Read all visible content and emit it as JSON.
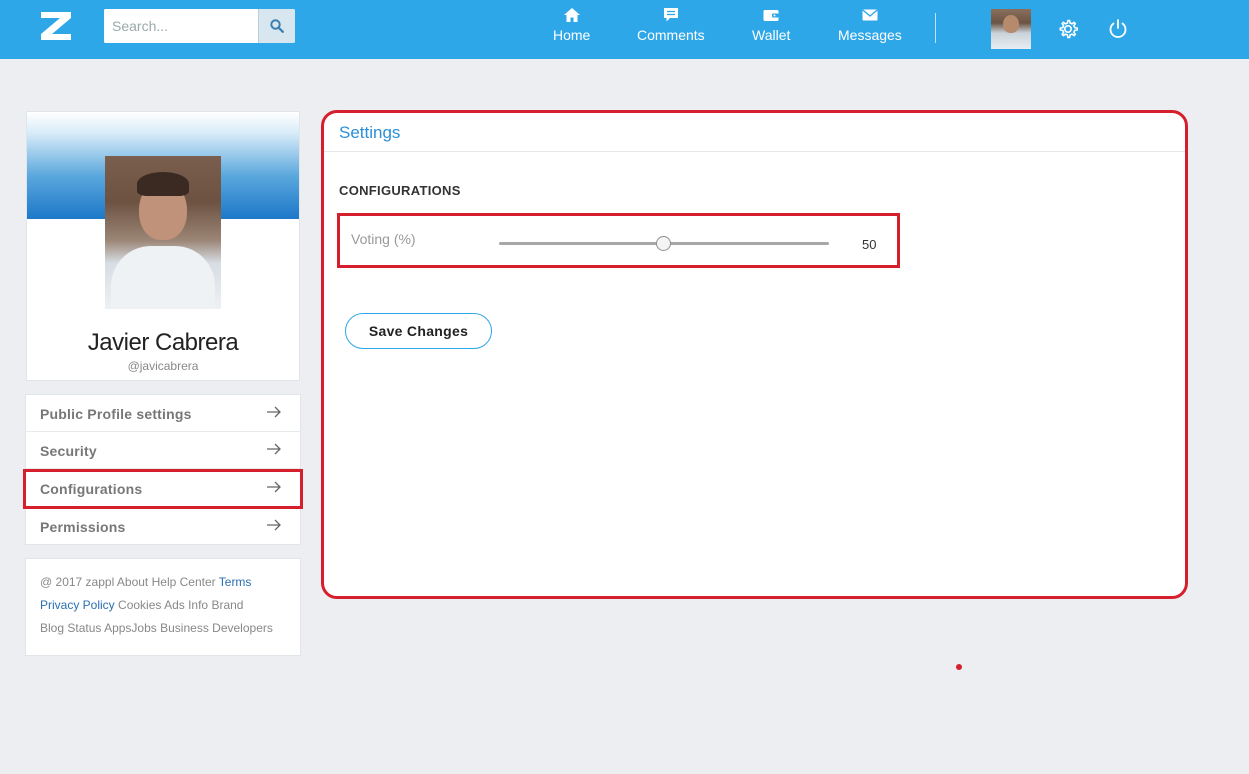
{
  "header": {
    "search_placeholder": "Search...",
    "nav": [
      {
        "label": "Home",
        "icon": "home-icon"
      },
      {
        "label": "Comments",
        "icon": "comment-icon"
      },
      {
        "label": "Wallet",
        "icon": "wallet-icon"
      },
      {
        "label": "Messages",
        "icon": "envelope-icon"
      }
    ],
    "accent_color": "#2ea7e8"
  },
  "profile": {
    "name": "Javier Cabrera",
    "handle": "@javicabrera"
  },
  "sidebar": {
    "items": [
      {
        "label": "Public Profile settings"
      },
      {
        "label": "Security"
      },
      {
        "label": "Configurations"
      },
      {
        "label": "Permissions"
      }
    ]
  },
  "footer": {
    "copyright": "@ 2017 zappl",
    "about": "About",
    "help": "Help Center",
    "terms": "Terms",
    "privacy": "Privacy Policy",
    "cookies": "Cookies",
    "ads": "Ads Info",
    "brand": "Brand",
    "blog": "Blog",
    "status": "Status",
    "apps": "AppsJobs",
    "business": "Business",
    "developers": "Developers"
  },
  "settings": {
    "title": "Settings",
    "section": "CONFIGURATIONS",
    "voting_label": "Voting (%)",
    "voting_value": "50",
    "save_label": "Save Changes"
  },
  "highlight_color": "#d61f2c"
}
